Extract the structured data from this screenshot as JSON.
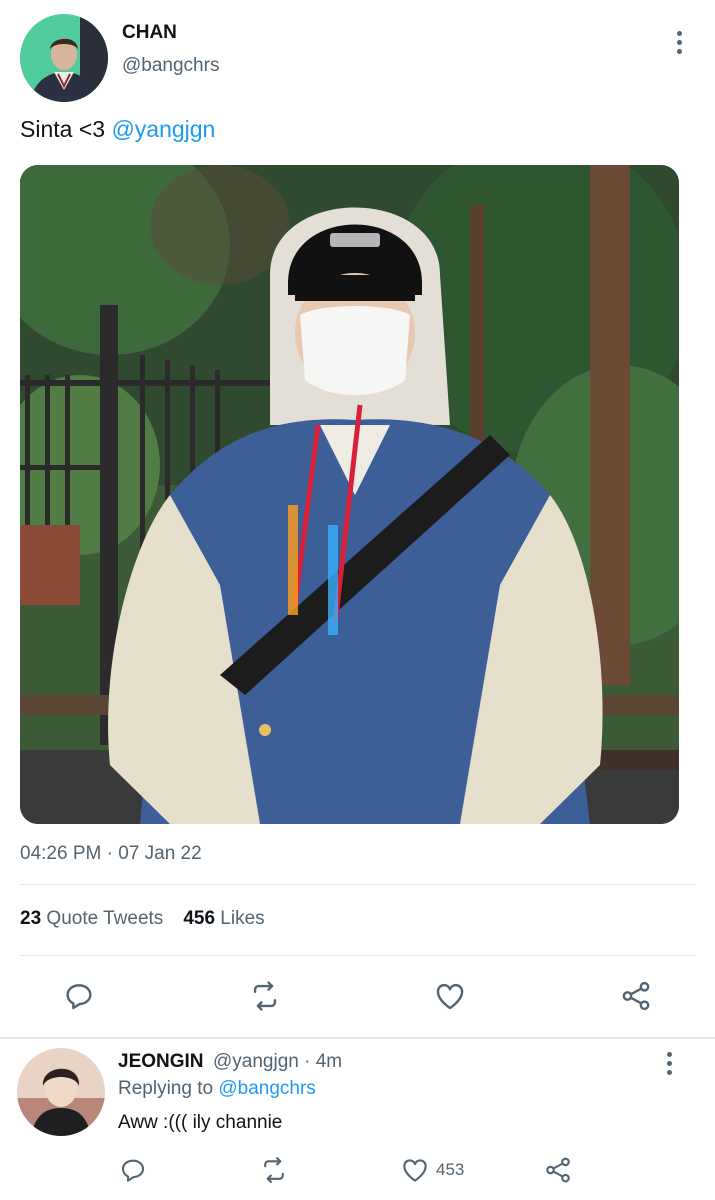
{
  "tweet": {
    "author": {
      "name": "CHAN",
      "handle": "@bangchrs"
    },
    "text": "Sinta <3",
    "mention": "@yangjgn",
    "timestamp": "04:26 PM · 07 Jan 22",
    "stats": {
      "quote_tweets_count": "23",
      "quote_tweets_label": "Quote Tweets",
      "likes_count": "456",
      "likes_label": "Likes"
    },
    "actions": [
      "reply-icon",
      "retweet-icon",
      "like-icon",
      "share-icon"
    ]
  },
  "reply": {
    "author": {
      "name": "JEONGIN",
      "handle": "@yangjgn",
      "time": "4m"
    },
    "replying_label": "Replying to",
    "replying_to": "@bangchrs",
    "text": "Aww :((( ily channie",
    "like_count": "453",
    "actions": [
      "reply-icon",
      "retweet-icon",
      "like-icon",
      "share-icon"
    ]
  },
  "colors": {
    "accent": "#1d9bf0",
    "text_primary": "#0f1419",
    "text_secondary": "#536471",
    "divider": "#e1e6ea"
  }
}
